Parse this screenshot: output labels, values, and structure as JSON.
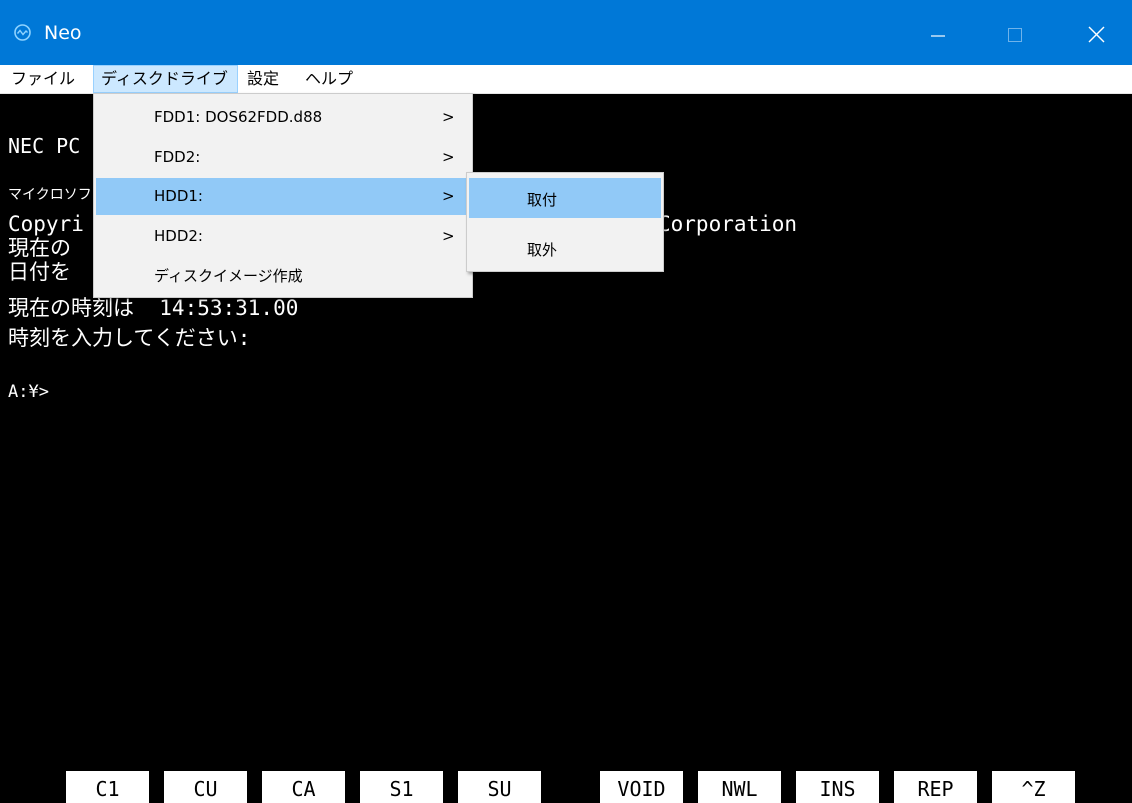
{
  "window": {
    "title": "Neo",
    "controls": {
      "minimize": "minimize-icon",
      "maximize": "maximize-icon",
      "close": "close-icon"
    },
    "accent": "#0078d7"
  },
  "menubar": {
    "file": "ファイル",
    "disk": "ディスクドライブ",
    "settings": "設定",
    "help": "ヘルプ"
  },
  "dropdown": {
    "items": [
      {
        "label": "FDD1: DOS62FDD.d88",
        "arrow": ">"
      },
      {
        "label": "FDD2:",
        "arrow": ">"
      },
      {
        "label": "HDD1:",
        "arrow": ">"
      },
      {
        "label": "HDD2:",
        "arrow": ">"
      },
      {
        "label": "ディスクイメージ作成",
        "arrow": ""
      }
    ],
    "highlight": "#91c9f7"
  },
  "submenu": {
    "items": [
      {
        "label": "取付"
      },
      {
        "label": "取外"
      }
    ]
  },
  "terminal": {
    "line1": "NEC PC",
    "line2": "マイクロソフ",
    "line3a": "Copyri",
    "line3b": "Corporation",
    "line4": "現在の",
    "line5": "日付を",
    "line6": "現在の時刻は  14:53:31.00",
    "line7": "時刻を入力してください:",
    "prompt": "A:¥>"
  },
  "function_keys": {
    "k1": "C1",
    "k2": "CU",
    "k3": "CA",
    "k4": "S1",
    "k5": "SU",
    "k6": "VOID",
    "k7": "NWL",
    "k8": "INS",
    "k9": "REP",
    "k10": "^Z"
  }
}
